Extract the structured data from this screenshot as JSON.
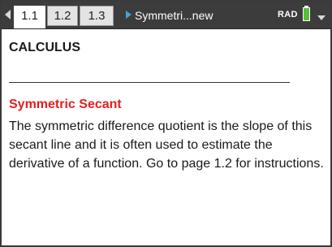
{
  "tabs": [
    {
      "label": "1.1",
      "active": true
    },
    {
      "label": "1.2",
      "active": false
    },
    {
      "label": "1.3",
      "active": false
    }
  ],
  "header": {
    "document_title": "Symmetri...new",
    "mode": "RAD",
    "battery_icon": "battery-icon",
    "nav_icon": "chevron-left-icon",
    "menu_icon": "chevron-down-icon",
    "doc_icon": "play-icon"
  },
  "page": {
    "heading": "CALCULUS",
    "subheading": "Symmetric Secant",
    "body": "The symmetric difference quotient is the slope of this secant line and it is often used to estimate the derivative of a function.  Go to page 1.2 for instructions."
  },
  "colors": {
    "topbar": "#3c3c3c",
    "subheading": "#e32020",
    "battery": "#55c13a",
    "doc_icon": "#3fa3e6"
  }
}
